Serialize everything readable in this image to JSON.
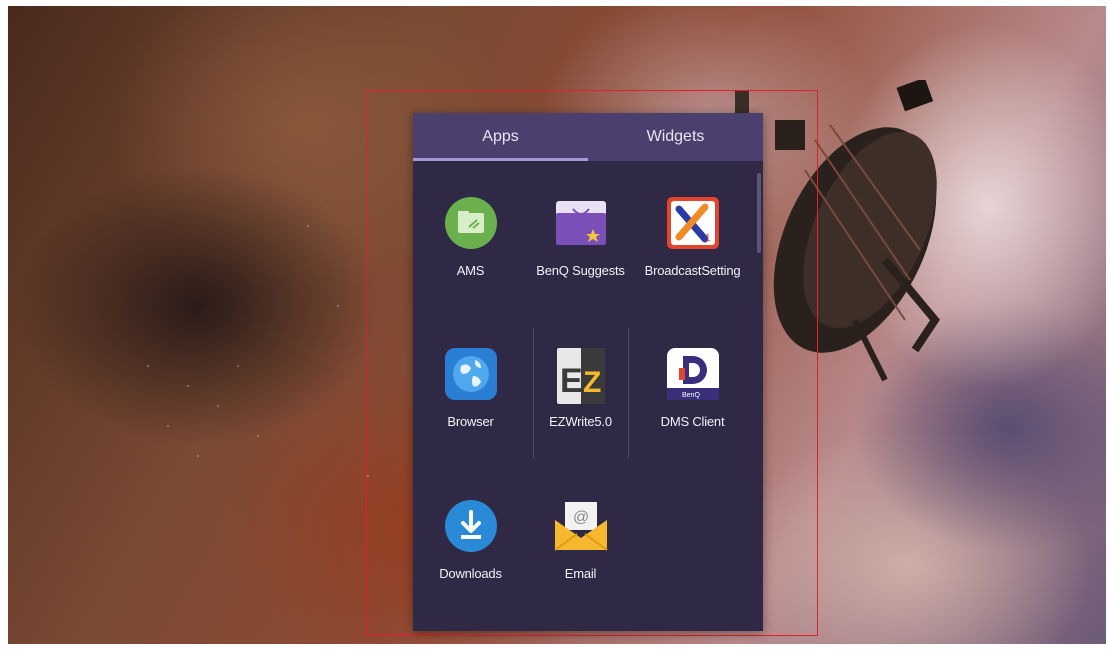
{
  "drawer": {
    "tabs": [
      {
        "label": "Apps",
        "active": true
      },
      {
        "label": "Widgets",
        "active": false
      }
    ],
    "apps": [
      {
        "label": "AMS",
        "icon": "folder-app-icon",
        "color": "#6ab04c"
      },
      {
        "label": "BenQ Suggests",
        "icon": "shopping-bag-icon",
        "color": "#7a4fb8"
      },
      {
        "label": "BroadcastSetting",
        "icon": "broadcast-x-icon",
        "color": "#f08a24"
      },
      {
        "label": "Browser",
        "icon": "globe-icon",
        "color": "#2a7fd4"
      },
      {
        "label": "EZWrite5.0",
        "icon": "ezwrite-icon",
        "color": "#e8e8e8"
      },
      {
        "label": "DMS Client",
        "icon": "dms-d-icon",
        "color": "#3a2f7a"
      },
      {
        "label": "Downloads",
        "icon": "download-icon",
        "color": "#2a8ad8"
      },
      {
        "label": "Email",
        "icon": "envelope-icon",
        "color": "#f5b82e"
      }
    ]
  },
  "colors": {
    "highlight": "#e0202a",
    "drawer_bg": "#2f2945",
    "tabbar_bg": "#4b406d"
  }
}
